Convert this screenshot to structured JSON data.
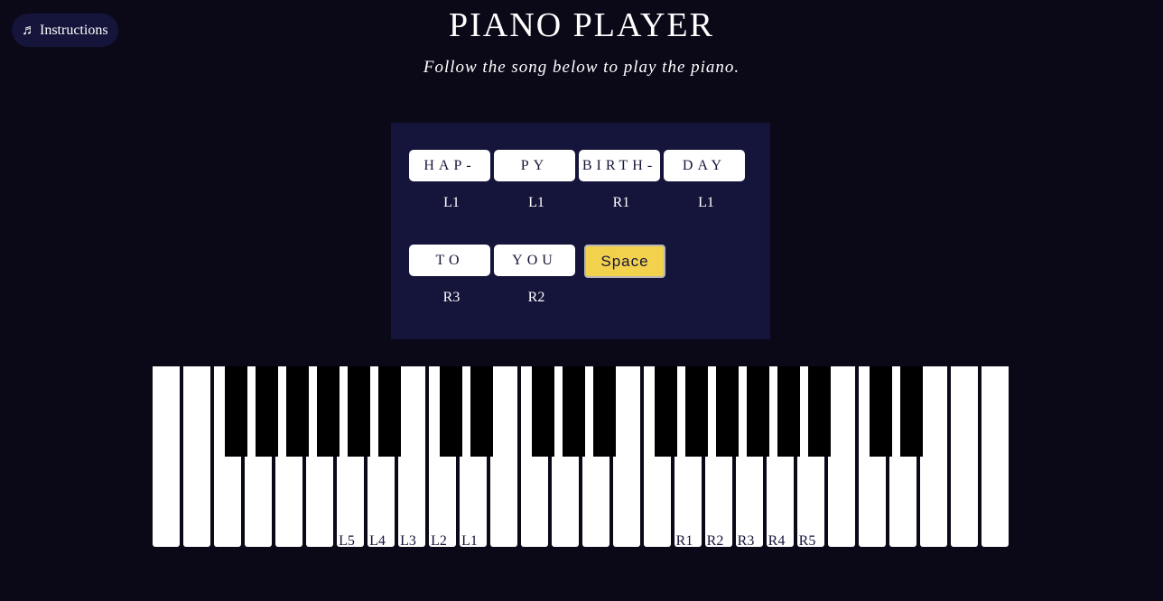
{
  "instructions_button": {
    "icon": "music-note-icon",
    "glyph": "♬",
    "label": "Instructions"
  },
  "header": {
    "title": "PIANO PLAYER",
    "subtitle": "Follow the song below to play the piano."
  },
  "song": {
    "words": [
      {
        "text": "HAP-",
        "hand": "L1"
      },
      {
        "text": "PY",
        "hand": "L1"
      },
      {
        "text": "BIRTH-",
        "hand": "R1"
      },
      {
        "text": "DAY",
        "hand": "L1"
      },
      {
        "text": "TO",
        "hand": "R3"
      },
      {
        "text": "YOU",
        "hand": "R2"
      }
    ],
    "space_label": "Space",
    "space_color": "#f2d24c"
  },
  "piano": {
    "white_key_count": 28,
    "black_key_count": 19,
    "key_labels": [
      "L5",
      "L4",
      "L3",
      "L2",
      "L1",
      "R1",
      "R2",
      "R3",
      "R4",
      "R5"
    ]
  },
  "colors": {
    "background": "#0b0818",
    "panel": "#15143a",
    "white_key": "#ffffff",
    "black_key": "#000000"
  }
}
